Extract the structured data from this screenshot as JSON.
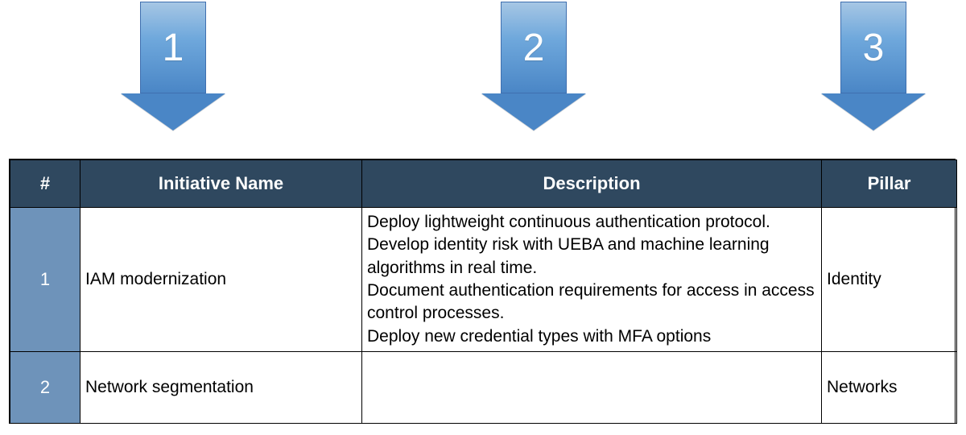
{
  "arrows": {
    "a1": "1",
    "a2": "2",
    "a3": "3"
  },
  "columns": {
    "idx": "#",
    "name": "Initiative Name",
    "desc": "Description",
    "pillar": "Pillar"
  },
  "rows": [
    {
      "idx": "1",
      "name": "IAM modernization",
      "desc": "Deploy lightweight continuous authentication protocol.\nDevelop identity risk with UEBA and machine learning algorithms in real time.\nDocument authentication requirements for access in access control processes.\nDeploy new credential types with MFA options",
      "pillar": "Identity"
    },
    {
      "idx": "2",
      "name": "Network segmentation",
      "desc": "",
      "pillar": "Networks"
    }
  ]
}
